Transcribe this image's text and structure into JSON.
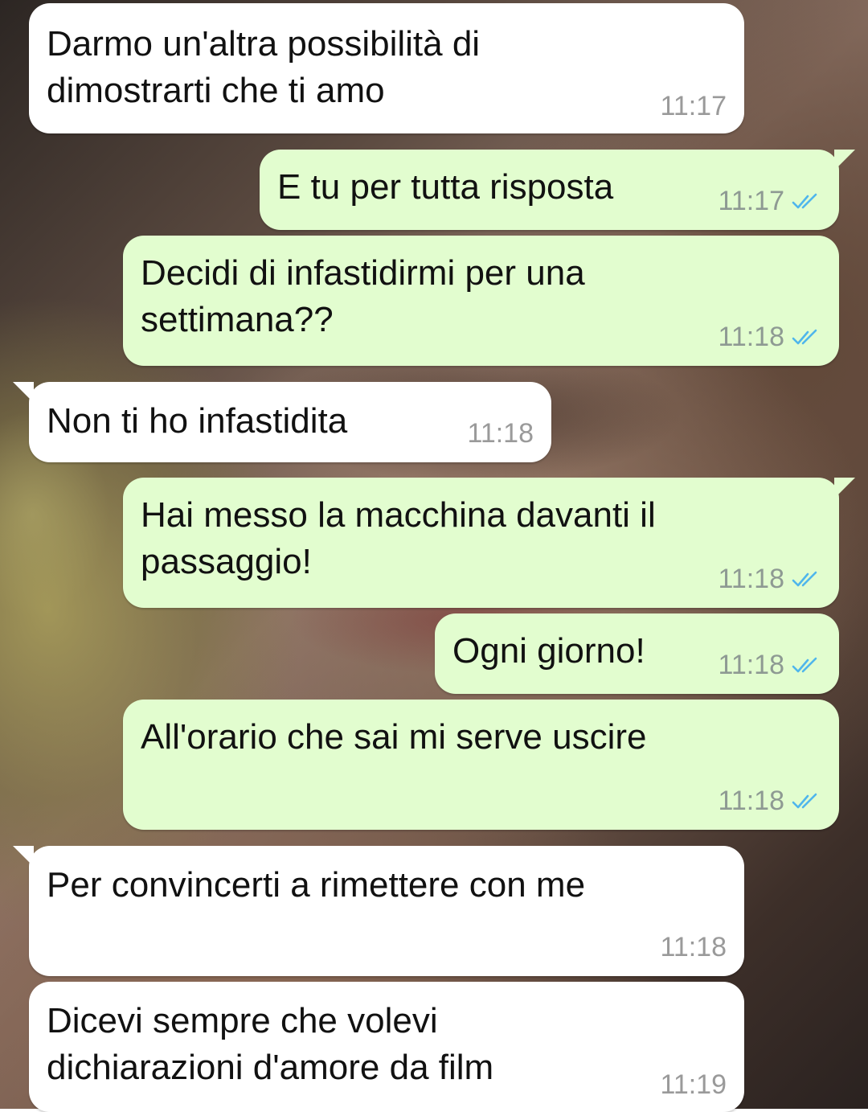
{
  "conversation": {
    "messages": [
      {
        "direction": "incoming",
        "text": "Darmo un'altra possibilità di\ndimostrarti che ti amo",
        "time": "11:17",
        "read": false
      },
      {
        "direction": "outgoing",
        "text": "E tu per tutta risposta",
        "time": "11:17",
        "read": true
      },
      {
        "direction": "outgoing",
        "text": "Decidi di infastidirmi per una\nsettimana??",
        "time": "11:18",
        "read": true
      },
      {
        "direction": "incoming",
        "text": "Non ti ho infastidita",
        "time": "11:18",
        "read": false
      },
      {
        "direction": "outgoing",
        "text": "Hai messo la macchina davanti il\npassaggio!",
        "time": "11:18",
        "read": true
      },
      {
        "direction": "outgoing",
        "text": "Ogni giorno!",
        "time": "11:18",
        "read": true
      },
      {
        "direction": "outgoing",
        "text": "All'orario che sai mi serve uscire",
        "time": "11:18",
        "read": true
      },
      {
        "direction": "incoming",
        "text": "Per convincerti a rimettere con me",
        "time": "11:18",
        "read": false
      },
      {
        "direction": "incoming",
        "text": "Dicevi sempre che volevi\ndichiarazioni d'amore da film",
        "time": "11:19",
        "read": false
      }
    ]
  },
  "colors": {
    "incoming_bubble": "#ffffff",
    "outgoing_bubble": "#e2fdcf",
    "read_ticks": "#4fb6ec",
    "timestamp": "#8e9a93"
  },
  "icons": {
    "read_receipt": "double-check-icon"
  }
}
